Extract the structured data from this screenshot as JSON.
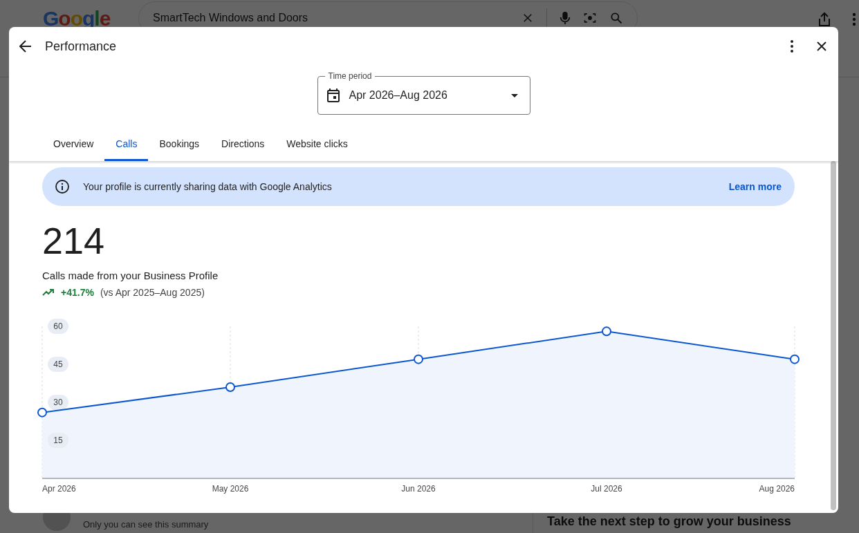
{
  "background_page": {
    "logo": "Google",
    "search": {
      "value": "SmartTech Windows and Doors"
    },
    "summary_note": "Only you can see this summary",
    "next_step_heading": "Take the next step to grow your business"
  },
  "dialog": {
    "title": "Performance",
    "time_period": {
      "label": "Time period",
      "value": "Apr 2026–Aug 2026"
    },
    "tabs": [
      {
        "label": "Overview",
        "selected": false
      },
      {
        "label": "Calls",
        "selected": true
      },
      {
        "label": "Bookings",
        "selected": false
      },
      {
        "label": "Directions",
        "selected": false
      },
      {
        "label": "Website clicks",
        "selected": false
      }
    ],
    "banner": {
      "text": "Your profile is currently sharing data with Google Analytics",
      "link": "Learn more"
    },
    "metric": {
      "value": "214",
      "caption": "Calls made from your Business Profile",
      "change": "+41.7%",
      "comparison": "(vs Apr 2025–Aug 2025)"
    },
    "chart_data": {
      "type": "area",
      "categories": [
        "Apr 2026",
        "May 2026",
        "Jun 2026",
        "Jul 2026",
        "Aug 2026"
      ],
      "series": [
        {
          "color": "#0b57d0",
          "values": [
            26,
            36,
            47,
            58,
            47
          ]
        }
      ],
      "ylim": [
        0,
        60
      ],
      "yticks": [
        15,
        30,
        45,
        60
      ],
      "grid": true
    }
  }
}
